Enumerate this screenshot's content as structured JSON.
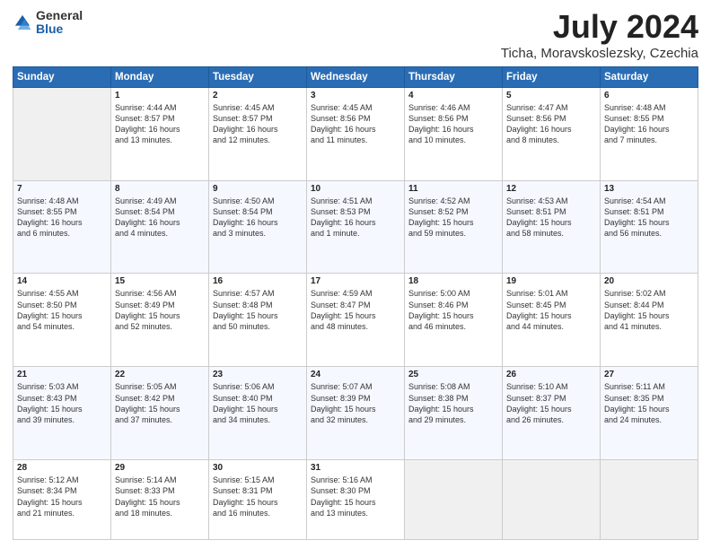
{
  "logo": {
    "general": "General",
    "blue": "Blue"
  },
  "title": "July 2024",
  "subtitle": "Ticha, Moravskoslezsky, Czechia",
  "headers": [
    "Sunday",
    "Monday",
    "Tuesday",
    "Wednesday",
    "Thursday",
    "Friday",
    "Saturday"
  ],
  "weeks": [
    [
      {
        "day": "",
        "info": ""
      },
      {
        "day": "1",
        "info": "Sunrise: 4:44 AM\nSunset: 8:57 PM\nDaylight: 16 hours\nand 13 minutes."
      },
      {
        "day": "2",
        "info": "Sunrise: 4:45 AM\nSunset: 8:57 PM\nDaylight: 16 hours\nand 12 minutes."
      },
      {
        "day": "3",
        "info": "Sunrise: 4:45 AM\nSunset: 8:56 PM\nDaylight: 16 hours\nand 11 minutes."
      },
      {
        "day": "4",
        "info": "Sunrise: 4:46 AM\nSunset: 8:56 PM\nDaylight: 16 hours\nand 10 minutes."
      },
      {
        "day": "5",
        "info": "Sunrise: 4:47 AM\nSunset: 8:56 PM\nDaylight: 16 hours\nand 8 minutes."
      },
      {
        "day": "6",
        "info": "Sunrise: 4:48 AM\nSunset: 8:55 PM\nDaylight: 16 hours\nand 7 minutes."
      }
    ],
    [
      {
        "day": "7",
        "info": "Sunrise: 4:48 AM\nSunset: 8:55 PM\nDaylight: 16 hours\nand 6 minutes."
      },
      {
        "day": "8",
        "info": "Sunrise: 4:49 AM\nSunset: 8:54 PM\nDaylight: 16 hours\nand 4 minutes."
      },
      {
        "day": "9",
        "info": "Sunrise: 4:50 AM\nSunset: 8:54 PM\nDaylight: 16 hours\nand 3 minutes."
      },
      {
        "day": "10",
        "info": "Sunrise: 4:51 AM\nSunset: 8:53 PM\nDaylight: 16 hours\nand 1 minute."
      },
      {
        "day": "11",
        "info": "Sunrise: 4:52 AM\nSunset: 8:52 PM\nDaylight: 15 hours\nand 59 minutes."
      },
      {
        "day": "12",
        "info": "Sunrise: 4:53 AM\nSunset: 8:51 PM\nDaylight: 15 hours\nand 58 minutes."
      },
      {
        "day": "13",
        "info": "Sunrise: 4:54 AM\nSunset: 8:51 PM\nDaylight: 15 hours\nand 56 minutes."
      }
    ],
    [
      {
        "day": "14",
        "info": "Sunrise: 4:55 AM\nSunset: 8:50 PM\nDaylight: 15 hours\nand 54 minutes."
      },
      {
        "day": "15",
        "info": "Sunrise: 4:56 AM\nSunset: 8:49 PM\nDaylight: 15 hours\nand 52 minutes."
      },
      {
        "day": "16",
        "info": "Sunrise: 4:57 AM\nSunset: 8:48 PM\nDaylight: 15 hours\nand 50 minutes."
      },
      {
        "day": "17",
        "info": "Sunrise: 4:59 AM\nSunset: 8:47 PM\nDaylight: 15 hours\nand 48 minutes."
      },
      {
        "day": "18",
        "info": "Sunrise: 5:00 AM\nSunset: 8:46 PM\nDaylight: 15 hours\nand 46 minutes."
      },
      {
        "day": "19",
        "info": "Sunrise: 5:01 AM\nSunset: 8:45 PM\nDaylight: 15 hours\nand 44 minutes."
      },
      {
        "day": "20",
        "info": "Sunrise: 5:02 AM\nSunset: 8:44 PM\nDaylight: 15 hours\nand 41 minutes."
      }
    ],
    [
      {
        "day": "21",
        "info": "Sunrise: 5:03 AM\nSunset: 8:43 PM\nDaylight: 15 hours\nand 39 minutes."
      },
      {
        "day": "22",
        "info": "Sunrise: 5:05 AM\nSunset: 8:42 PM\nDaylight: 15 hours\nand 37 minutes."
      },
      {
        "day": "23",
        "info": "Sunrise: 5:06 AM\nSunset: 8:40 PM\nDaylight: 15 hours\nand 34 minutes."
      },
      {
        "day": "24",
        "info": "Sunrise: 5:07 AM\nSunset: 8:39 PM\nDaylight: 15 hours\nand 32 minutes."
      },
      {
        "day": "25",
        "info": "Sunrise: 5:08 AM\nSunset: 8:38 PM\nDaylight: 15 hours\nand 29 minutes."
      },
      {
        "day": "26",
        "info": "Sunrise: 5:10 AM\nSunset: 8:37 PM\nDaylight: 15 hours\nand 26 minutes."
      },
      {
        "day": "27",
        "info": "Sunrise: 5:11 AM\nSunset: 8:35 PM\nDaylight: 15 hours\nand 24 minutes."
      }
    ],
    [
      {
        "day": "28",
        "info": "Sunrise: 5:12 AM\nSunset: 8:34 PM\nDaylight: 15 hours\nand 21 minutes."
      },
      {
        "day": "29",
        "info": "Sunrise: 5:14 AM\nSunset: 8:33 PM\nDaylight: 15 hours\nand 18 minutes."
      },
      {
        "day": "30",
        "info": "Sunrise: 5:15 AM\nSunset: 8:31 PM\nDaylight: 15 hours\nand 16 minutes."
      },
      {
        "day": "31",
        "info": "Sunrise: 5:16 AM\nSunset: 8:30 PM\nDaylight: 15 hours\nand 13 minutes."
      },
      {
        "day": "",
        "info": ""
      },
      {
        "day": "",
        "info": ""
      },
      {
        "day": "",
        "info": ""
      }
    ]
  ]
}
